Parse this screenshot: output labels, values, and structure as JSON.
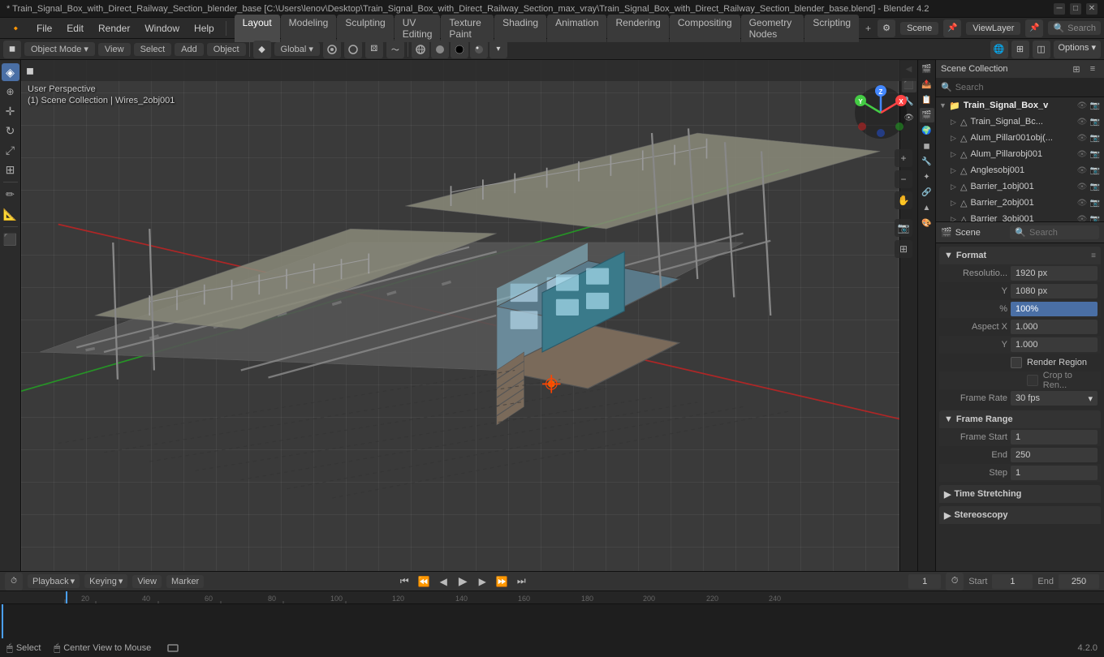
{
  "titlebar": {
    "title": "* Train_Signal_Box_with_Direct_Railway_Section_blender_base [C:\\Users\\lenov\\Desktop\\Train_Signal_Box_with_Direct_Railway_Section_max_vray\\Train_Signal_Box_with_Direct_Railway_Section_blender_base.blend] - Blender 4.2",
    "minimize": "─",
    "maximize": "□",
    "close": "✕"
  },
  "menubar": {
    "items": [
      "Blender",
      "File",
      "Edit",
      "Render",
      "Window",
      "Help"
    ],
    "workspaces": [
      "Layout",
      "Modeling",
      "Sculpting",
      "UV Editing",
      "Texture Paint",
      "Shading",
      "Animation",
      "Rendering",
      "Compositing",
      "Geometry Nodes",
      "Scripting"
    ],
    "active_workspace": "Layout"
  },
  "header_toolbar": {
    "object_mode": "Object Mode",
    "view": "View",
    "select": "Select",
    "add": "Add",
    "object": "Object",
    "transform_orientation": "Global",
    "snap": "⊞",
    "proportional": "○",
    "scene": "Scene",
    "view_layer": "ViewLayer",
    "search_placeholder": "Search"
  },
  "viewport": {
    "perspective": "User Perspective",
    "collection_path": "(1) Scene Collection | Wires_2obj001",
    "options_label": "Options"
  },
  "outliner": {
    "title": "Scene Collection",
    "search_placeholder": "Search",
    "items": [
      {
        "name": "Train_Signal_Box_v",
        "type": "collection",
        "depth": 0,
        "expanded": true
      },
      {
        "name": "Train_Signal_Bc...",
        "type": "mesh",
        "depth": 1
      },
      {
        "name": "Alum_Pillar001obj(...",
        "type": "mesh",
        "depth": 1
      },
      {
        "name": "Alum_Pillarobj001",
        "type": "mesh",
        "depth": 1
      },
      {
        "name": "Anglesobj001",
        "type": "mesh",
        "depth": 1
      },
      {
        "name": "Barrier_1obj001",
        "type": "mesh",
        "depth": 1
      },
      {
        "name": "Barrier_2obj001",
        "type": "mesh",
        "depth": 1
      },
      {
        "name": "Barrier_3obj001",
        "type": "mesh",
        "depth": 1
      }
    ]
  },
  "properties": {
    "active_tab": "render",
    "tabs": [
      {
        "icon": "🎬",
        "name": "render-tab",
        "label": "Render"
      },
      {
        "icon": "📷",
        "name": "output-tab",
        "label": "Output"
      },
      {
        "icon": "👁",
        "name": "view-layer-tab",
        "label": "View Layer"
      },
      {
        "icon": "🌍",
        "name": "scene-tab",
        "label": "Scene"
      },
      {
        "icon": "🌐",
        "name": "world-tab",
        "label": "World"
      },
      {
        "icon": "⚙",
        "name": "object-tab",
        "label": "Object"
      },
      {
        "icon": "✦",
        "name": "modifier-tab",
        "label": "Modifier"
      },
      {
        "icon": "▲",
        "name": "particles-tab",
        "label": "Particles"
      },
      {
        "icon": "🔗",
        "name": "constraints-tab",
        "label": "Constraints"
      },
      {
        "icon": "📐",
        "name": "data-tab",
        "label": "Data"
      },
      {
        "icon": "🎨",
        "name": "material-tab",
        "label": "Material"
      }
    ],
    "scene_label": "Scene",
    "search_placeholder": "Search",
    "format_section": {
      "title": "Format",
      "resolution_x_label": "Resolutio...",
      "resolution_x": "1920 px",
      "resolution_y_label": "Y",
      "resolution_y": "1080 px",
      "resolution_pct_label": "%",
      "resolution_pct": "100%",
      "aspect_x_label": "Aspect X",
      "aspect_x": "1.000",
      "aspect_y_label": "Y",
      "aspect_y": "1.000",
      "render_region_label": "Render Region",
      "crop_label": "Crop to Ren...",
      "frame_rate_label": "Frame Rate",
      "frame_rate": "30 fps"
    },
    "frame_range_section": {
      "title": "Frame Range",
      "start_label": "Frame Start",
      "start": "1",
      "end_label": "End",
      "end": "250",
      "step_label": "Step",
      "step": "1"
    },
    "time_stretching_section": {
      "title": "Time Stretching",
      "expanded": false
    },
    "stereoscopy_section": {
      "title": "Stereoscopy",
      "expanded": false
    }
  },
  "timeline": {
    "playback_label": "Playback",
    "keying_label": "Keying",
    "view_label": "View",
    "marker_label": "Marker",
    "current_frame": "1",
    "start_label": "Start",
    "start_frame": "1",
    "end_label": "End",
    "end_frame": "250",
    "transport_buttons": [
      "⏮",
      "⏪",
      "⏴",
      "▶",
      "⏵",
      "⏩",
      "⏭"
    ]
  },
  "statusbar": {
    "select_label": "Select",
    "center_view_label": "Center View to Mouse",
    "version": "4.2.0",
    "mouse_icon": "🖱",
    "select_icon": "◉"
  },
  "colors": {
    "accent_blue": "#4a6fa5",
    "bg_dark": "#1a1a1a",
    "bg_medium": "#2b2b2b",
    "bg_light": "#3a3a3a",
    "text_primary": "#cccccc",
    "text_secondary": "#999999",
    "highlight": "#4a6fa5",
    "percent_bar": "#4a6fa5"
  }
}
